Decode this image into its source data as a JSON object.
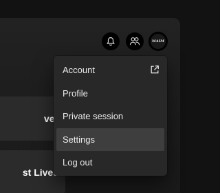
{
  "header": {
    "bell_icon": "bell-icon",
    "friends_icon": "friends-activity-icon",
    "avatar_text": "MAIM"
  },
  "background_cards": [
    {
      "title": "ver"
    },
    {
      "title": "st Lives"
    }
  ],
  "account_menu": {
    "items": [
      {
        "label": "Account",
        "icon": "external-link-icon"
      },
      {
        "label": "Profile"
      },
      {
        "label": "Private session"
      },
      {
        "label": "Settings",
        "hovered": true
      },
      {
        "label": "Log out"
      }
    ]
  },
  "colors": {
    "background": "#121212",
    "menu_background": "#282828",
    "menu_hover": "#3e3e3e",
    "text": "#eaeaea"
  }
}
